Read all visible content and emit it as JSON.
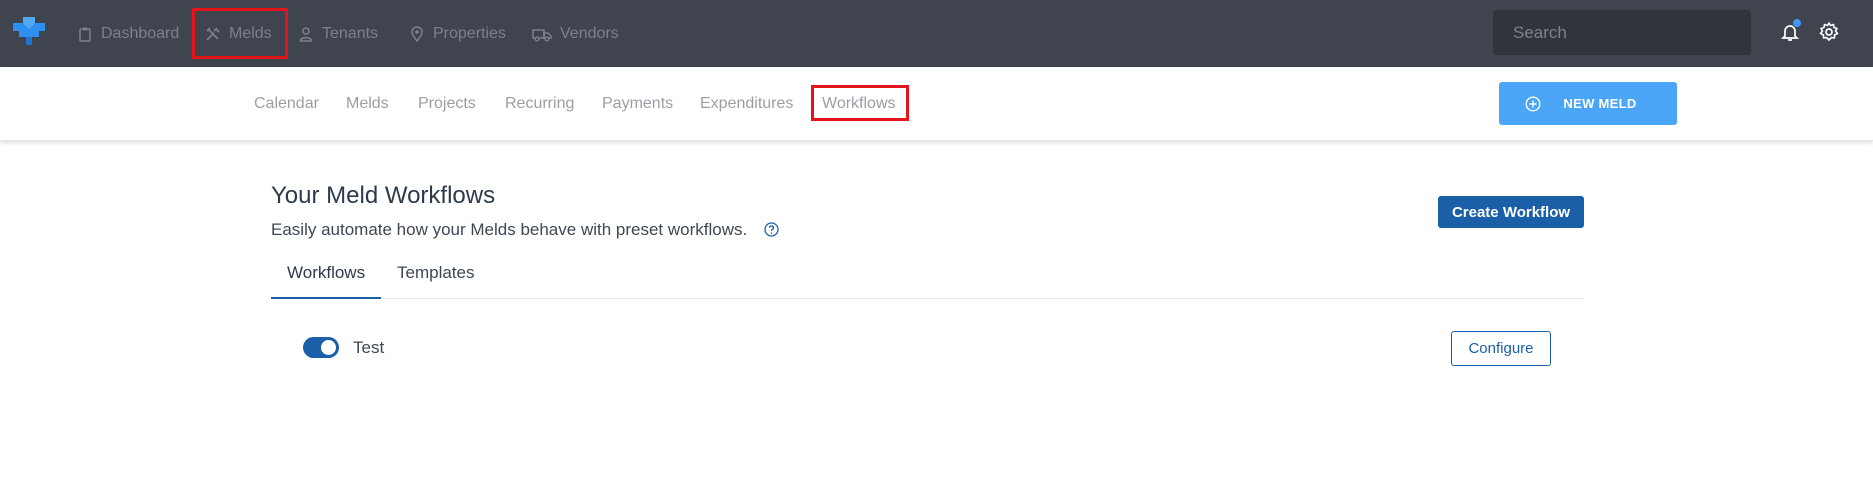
{
  "nav": {
    "items": [
      {
        "label": "Dashboard",
        "icon": "clipboard-icon"
      },
      {
        "label": "Melds",
        "icon": "tools-icon"
      },
      {
        "label": "Tenants",
        "icon": "person-icon"
      },
      {
        "label": "Properties",
        "icon": "map-pin-icon"
      },
      {
        "label": "Vendors",
        "icon": "truck-icon"
      }
    ],
    "search_placeholder": "Search"
  },
  "subnav": {
    "items": [
      "Calendar",
      "Melds",
      "Projects",
      "Recurring",
      "Payments",
      "Expenditures",
      "Workflows"
    ],
    "new_meld_label": "NEW MELD"
  },
  "main": {
    "title": "Your Meld Workflows",
    "subtitle": "Easily automate how your Melds behave with preset workflows.",
    "create_label": "Create Workflow",
    "tabs": [
      {
        "label": "Workflows",
        "active": true
      },
      {
        "label": "Templates",
        "active": false
      }
    ],
    "workflows": [
      {
        "name": "Test",
        "enabled": true,
        "action_label": "Configure"
      }
    ]
  },
  "colors": {
    "topbar": "#3f444f",
    "accent": "#1a5fa8",
    "new_meld": "#4ba6f7",
    "highlight": "#e3141b"
  }
}
